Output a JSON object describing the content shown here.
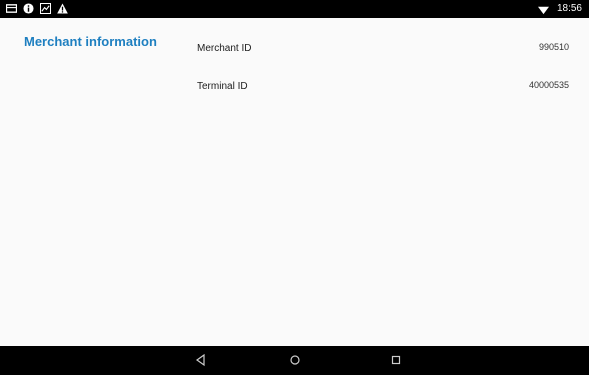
{
  "status_bar": {
    "icons_left": [
      "sim-card-icon",
      "info-icon",
      "image-icon",
      "warning-icon"
    ],
    "wifi_icon": "wifi-icon",
    "time": "18:56"
  },
  "section": {
    "title": "Merchant information"
  },
  "rows": [
    {
      "label": "Merchant ID",
      "value": "990510"
    },
    {
      "label": "Terminal ID",
      "value": "40000535"
    }
  ],
  "nav_bar": {
    "icons": [
      "back-icon",
      "home-icon",
      "recents-icon"
    ]
  },
  "colors": {
    "accent": "#1e7fc0",
    "background": "#fafafa",
    "bars": "#000000"
  }
}
